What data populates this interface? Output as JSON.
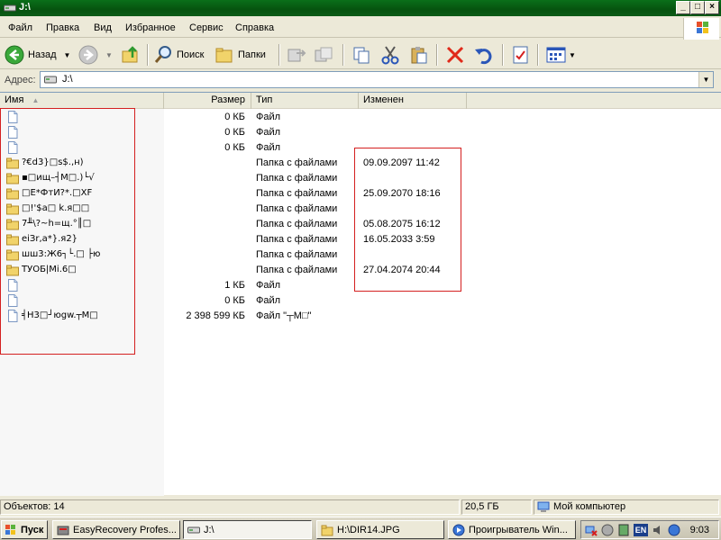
{
  "window": {
    "title": "J:\\"
  },
  "menu": [
    "Файл",
    "Правка",
    "Вид",
    "Избранное",
    "Сервис",
    "Справка"
  ],
  "toolbar": {
    "back_label": "Назад",
    "search_label": "Поиск",
    "folders_label": "Папки"
  },
  "address": {
    "label": "Адрес:",
    "value": "J:\\"
  },
  "columns": {
    "name": "Имя",
    "size": "Размер",
    "type": "Тип",
    "modified": "Изменен"
  },
  "files": [
    {
      "name": "",
      "size": "0 КБ",
      "type": "Файл",
      "date": "",
      "kind": "file"
    },
    {
      "name": "",
      "size": "0 КБ",
      "type": "Файл",
      "date": "",
      "kind": "file"
    },
    {
      "name": "",
      "size": "0 КБ",
      "type": "Файл",
      "date": "",
      "kind": "file"
    },
    {
      "name": "?€d3}□s$.,н)",
      "size": "",
      "type": "Папка с файлами",
      "date": "09.09.2097 11:42",
      "kind": "folder"
    },
    {
      "name": "▪□ищ–┤М□.)└√",
      "size": "",
      "type": "Папка с файлами",
      "date": "",
      "kind": "folder"
    },
    {
      "name": "□E*ФтИ?*.□XF",
      "size": "",
      "type": "Папка с файлами",
      "date": "25.09.2070 18:16",
      "kind": "folder"
    },
    {
      "name": "□!'$a□ k.я□□",
      "size": "",
      "type": "Папка с файлами",
      "date": "",
      "kind": "folder"
    },
    {
      "name": "7╨\\?~h=щ.°║□",
      "size": "",
      "type": "Папка с файлами",
      "date": "05.08.2075 16:12",
      "kind": "folder"
    },
    {
      "name": "eiЗr,a*}.я2}",
      "size": "",
      "type": "Папка с файлами",
      "date": "16.05.2033 3:59",
      "kind": "folder"
    },
    {
      "name": "шш3:Ж6┐└.□ ├ю",
      "size": "",
      "type": "Папка с файлами",
      "date": "",
      "kind": "folder"
    },
    {
      "name": "ТУОБ|Mi.6□",
      "size": "",
      "type": "Папка с файлами",
      "date": "27.04.2074 20:44",
      "kind": "folder"
    },
    {
      "name": "",
      "size": "1 КБ",
      "type": "Файл",
      "date": "",
      "kind": "file"
    },
    {
      "name": "",
      "size": "0 КБ",
      "type": "Файл",
      "date": "",
      "kind": "file"
    },
    {
      "name": "╡Н3□┘юgw.┬М□",
      "size": "2 398 599 КБ",
      "type": "Файл \"┬М□\"",
      "date": "",
      "kind": "file"
    }
  ],
  "status": {
    "objects": "Объектов: 14",
    "size": "20,5 ГБ",
    "location": "Мой компьютер"
  },
  "taskbar": {
    "start": "Пуск",
    "tasks": [
      "EasyRecovery Profes...",
      "J:\\",
      "H:\\DIR14.JPG",
      "Проигрыватель Win..."
    ],
    "lang": "EN",
    "clock": "9:03"
  },
  "colors": {
    "title_bar": "#0a6f1a",
    "highlight_box": "#d42020",
    "folder": "#f1d36a"
  }
}
